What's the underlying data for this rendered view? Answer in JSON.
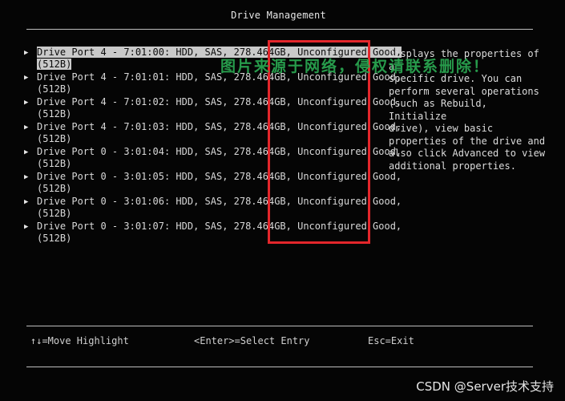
{
  "title": "Drive Management",
  "drives": [
    {
      "line1": "Drive Port 4 - 7:01:00: HDD, SAS, 278.464GB, Unconfigured Good,",
      "line2": "(512B)",
      "selected": true
    },
    {
      "line1": "Drive Port 4 - 7:01:01: HDD, SAS, 278.464GB, Unconfigured Good,",
      "line2": "(512B)",
      "selected": false
    },
    {
      "line1": "Drive Port 4 - 7:01:02: HDD, SAS, 278.464GB, Unconfigured Good,",
      "line2": "(512B)",
      "selected": false
    },
    {
      "line1": "Drive Port 4 - 7:01:03: HDD, SAS, 278.464GB, Unconfigured Good,",
      "line2": "(512B)",
      "selected": false
    },
    {
      "line1": "Drive Port 0 - 3:01:04: HDD, SAS, 278.464GB, Unconfigured Good,",
      "line2": "(512B)",
      "selected": false
    },
    {
      "line1": "Drive Port 0 - 3:01:05: HDD, SAS, 278.464GB, Unconfigured Good,",
      "line2": "(512B)",
      "selected": false
    },
    {
      "line1": "Drive Port 0 - 3:01:06: HDD, SAS, 278.464GB, Unconfigured Good,",
      "line2": "(512B)",
      "selected": false
    },
    {
      "line1": "Drive Port 0 - 3:01:07: HDD, SAS, 278.464GB, Unconfigured Good,",
      "line2": "(512B)",
      "selected": false
    }
  ],
  "help_text": "Displays the properties of a\nspecific drive. You can\nperform several operations\n(such as Rebuild, Initialize\ndrive), view basic\nproperties of the drive and\nalso click Advanced to view\nadditional properties.",
  "watermark": "图片来源于网络，侵权请联系删除！",
  "footer": {
    "move": "↑↓=Move Highlight",
    "enter": "<Enter>=Select Entry",
    "esc": "Esc=Exit"
  },
  "credit": "CSDN @Server技术支持",
  "colors": {
    "background": "#050505",
    "text": "#d8d8d8",
    "selection": "#c9c9c9",
    "highlight_box": "#e3262b",
    "watermark": "#2aa852"
  },
  "icons": {
    "pointer": "triangle-right-icon"
  }
}
